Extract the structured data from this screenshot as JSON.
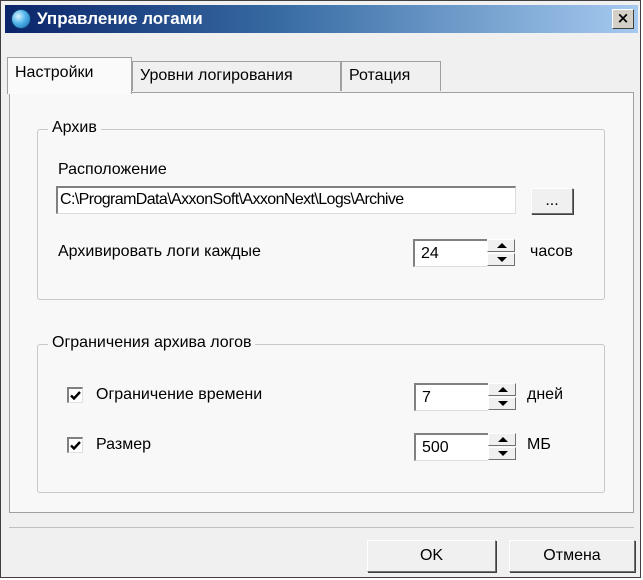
{
  "window": {
    "title": "Управление логами",
    "close_glyph": "×",
    "icon": "app-hexagon-icon"
  },
  "tabs": [
    {
      "label": "Настройки",
      "active": true
    },
    {
      "label": "Уровни логирования",
      "active": false
    },
    {
      "label": "Ротация",
      "active": false
    }
  ],
  "archive": {
    "group_label": "Архив",
    "location_label": "Расположение",
    "location_value": "C:\\ProgramData\\AxxonSoft\\AxxonNext\\Logs\\Archive",
    "browse_label": "...",
    "interval_label": "Архивировать логи каждые",
    "interval_value": "24",
    "interval_unit": "часов"
  },
  "limits": {
    "group_label": "Ограничения архива логов",
    "time_checked": true,
    "time_label": "Ограничение времени",
    "time_value": "7",
    "time_unit": "дней",
    "size_checked": true,
    "size_label": "Размер",
    "size_value": "500",
    "size_unit": "МБ"
  },
  "footer": {
    "ok_label": "OK",
    "cancel_label": "Отмена"
  }
}
